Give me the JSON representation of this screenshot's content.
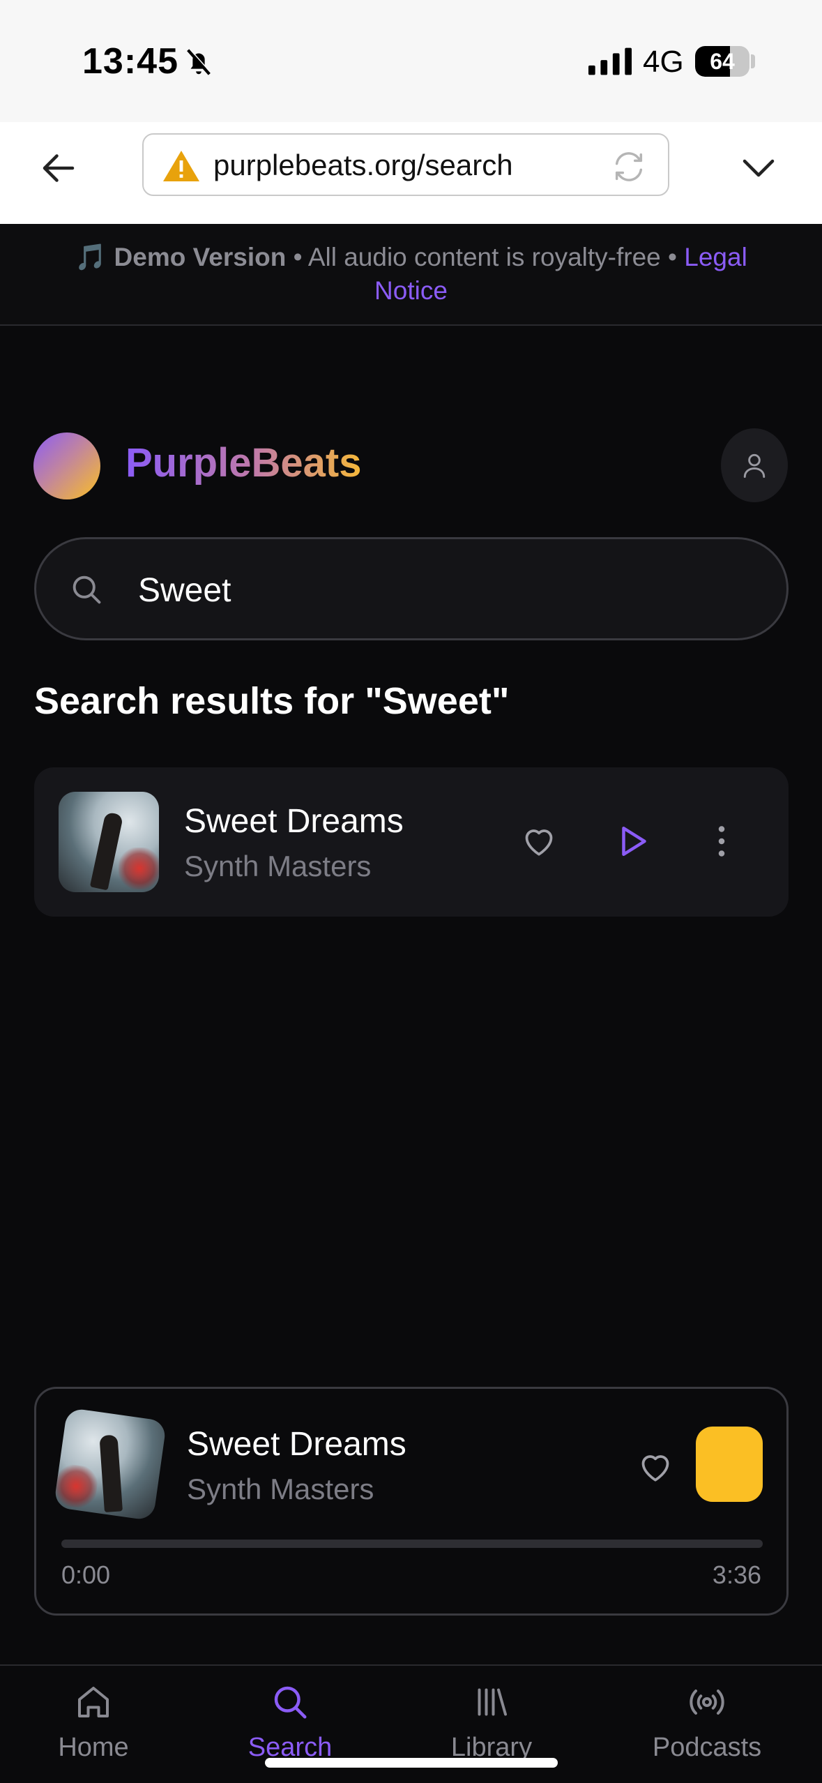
{
  "status_bar": {
    "time": "13:45",
    "network": "4G",
    "battery_level": "64",
    "battery_fraction": 0.64
  },
  "browser": {
    "url": "purplebeats.org/search",
    "icons": [
      "back-arrow-icon",
      "warning-icon",
      "reload-icon",
      "chevron-down-icon"
    ]
  },
  "banner": {
    "emoji": "🎵",
    "strong": "Demo Version",
    "separator": "•",
    "text": "All audio content is royalty-free",
    "link": "Legal Notice"
  },
  "header": {
    "brand": "PurpleBeats"
  },
  "search": {
    "value": "Sweet",
    "results_title": "Search results for \"Sweet\""
  },
  "results": [
    {
      "title": "Sweet Dreams",
      "artist": "Synth Masters"
    }
  ],
  "player": {
    "title": "Sweet Dreams",
    "artist": "Synth Masters",
    "current_time": "0:00",
    "total_time": "3:36",
    "progress": 0,
    "accent": "#fbbf24"
  },
  "nav": {
    "items": [
      {
        "label": "Home",
        "icon": "home-icon"
      },
      {
        "label": "Search",
        "icon": "search-icon"
      },
      {
        "label": "Library",
        "icon": "library-icon"
      },
      {
        "label": "Podcasts",
        "icon": "podcasts-icon"
      }
    ],
    "active": "Search"
  },
  "colors": {
    "accent_purple": "#8b5cf6",
    "accent_yellow": "#fbbf24",
    "background": "#0a0a0c"
  }
}
